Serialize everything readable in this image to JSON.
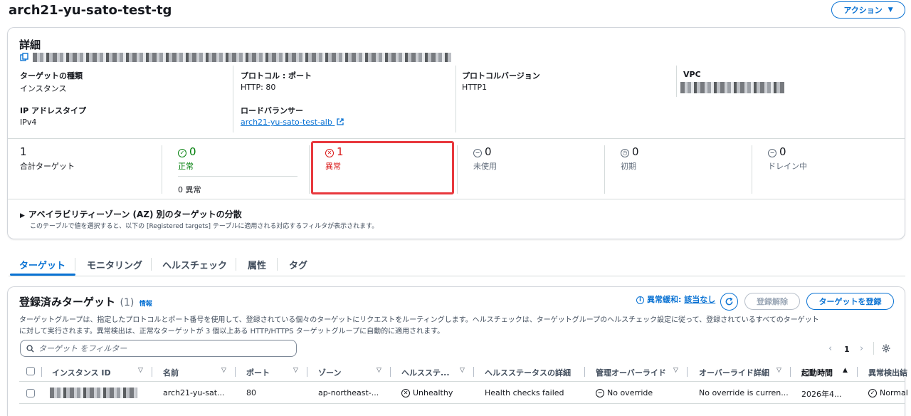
{
  "page": {
    "title": "arch21-yu-sato-test-tg",
    "action_label": "アクション"
  },
  "details": {
    "heading": "詳細",
    "fields": [
      {
        "label": "ターゲットの種類",
        "value": "インスタンス"
      },
      {
        "label": "プロトコル : ポート",
        "value": "HTTP: 80"
      },
      {
        "label": "プロトコルバージョン",
        "value": "HTTP1"
      },
      {
        "label": "VPC",
        "value": ""
      },
      {
        "label": "IP アドレスタイプ",
        "value": "IPv4"
      },
      {
        "label": "ロードバランサー",
        "value": "arch21-yu-sato-test-alb"
      }
    ]
  },
  "status": {
    "total": {
      "count": "1",
      "label": "合計ターゲット"
    },
    "healthy": {
      "count": "0",
      "label": "正常",
      "sub": "0 異常"
    },
    "unhealthy": {
      "count": "1",
      "label": "異常"
    },
    "unused": {
      "count": "0",
      "label": "未使用"
    },
    "initial": {
      "count": "0",
      "label": "初期"
    },
    "draining": {
      "count": "0",
      "label": "ドレイン中"
    }
  },
  "az": {
    "title": "アベイラビリティーゾーン (AZ) 別のターゲットの分散",
    "description": "このテーブルで値を選択すると、以下の [Registered targets] テーブルに適用される対応するフィルタが表示されます。"
  },
  "tabs": [
    "ターゲット",
    "モニタリング",
    "ヘルスチェック",
    "属性",
    "タグ"
  ],
  "targets": {
    "heading": "登録済みターゲット",
    "count": "(1)",
    "info": "情報",
    "anomaly_label": "異常緩和:",
    "anomaly_value": "該当なし",
    "deregister_label": "登録解除",
    "register_label": "ターゲットを登録",
    "description_1": "ターゲットグループは、指定したプロトコルとポート番号を使用して、登録されている個々のターゲットにリクエストをルーティングします。ヘルスチェックは、ターゲットグループのヘルスチェック設定に従って、登録されているすべてのターゲット",
    "description_2": "に対して実行されます。異常検出は、正常なターゲットが 3 個以上ある HTTP/HTTPS ターゲットグループに自動的に適用されます。",
    "search_placeholder": "ターゲット をフィルター",
    "page": "1",
    "columns": [
      "インスタンス ID",
      "名前",
      "ポート",
      "ゾーン",
      "ヘルスステ...",
      "ヘルスステータスの詳細",
      "管理オーバーライド",
      "オーバーライド詳細",
      "起動時間",
      "異常検出結"
    ],
    "row": {
      "name": "arch21-yu-sat...",
      "port": "80",
      "zone": "ap-northeast-...",
      "health": "Unhealthy",
      "health_detail": "Health checks failed",
      "admin_override": "No override",
      "override_detail": "No override is curren...",
      "launch_time": "2026年4...",
      "anomaly": "Normal"
    }
  },
  "colors": {
    "accent": "#0972d3",
    "healthy": "#037f0c",
    "unhealthy": "#d91515",
    "highlight": "#e8383d"
  }
}
